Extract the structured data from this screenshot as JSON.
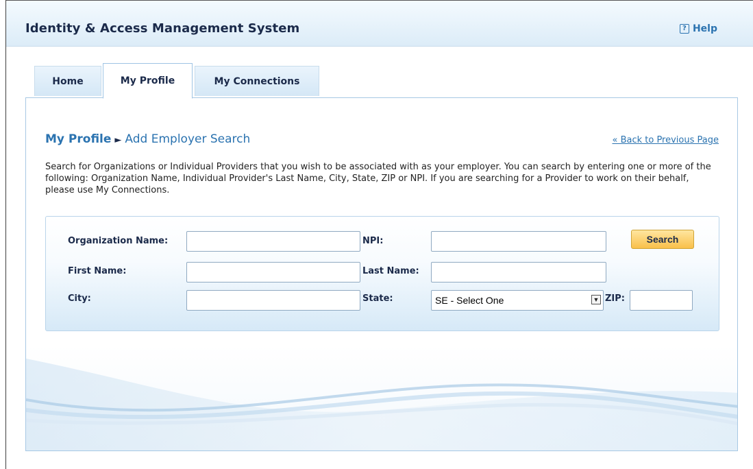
{
  "header": {
    "title": "Identity & Access Management System",
    "help_icon": "?",
    "help_label": "Help"
  },
  "tabs": [
    {
      "label": "Home",
      "active": false
    },
    {
      "label": "My Profile",
      "active": true
    },
    {
      "label": "My Connections",
      "active": false
    }
  ],
  "breadcrumb": {
    "section": "My Profile",
    "arrow": "►",
    "page": "Add Employer Search"
  },
  "back_link": "« Back to Previous Page",
  "description": "Search for Organizations or Individual Providers that you wish to be associated with as your employer. You can search by entering one or more of the following: Organization Name, Individual Provider's Last Name, City, State, ZIP or NPI. If you are searching for a Provider to work on their behalf, please use My Connections.",
  "form": {
    "organization_name_label": "Organization Name:",
    "organization_name_value": "",
    "npi_label": "NPI:",
    "npi_value": "",
    "first_name_label": "First Name:",
    "first_name_value": "",
    "last_name_label": "Last Name:",
    "last_name_value": "",
    "city_label": "City:",
    "city_value": "",
    "state_label": "State:",
    "state_selected": "SE - Select One",
    "zip_label": "ZIP:",
    "zip_value": "",
    "search_button": "Search"
  },
  "colors": {
    "link_blue": "#2b73b0",
    "heading_navy": "#1b2a4a",
    "button_gold": "#f9c04a"
  }
}
